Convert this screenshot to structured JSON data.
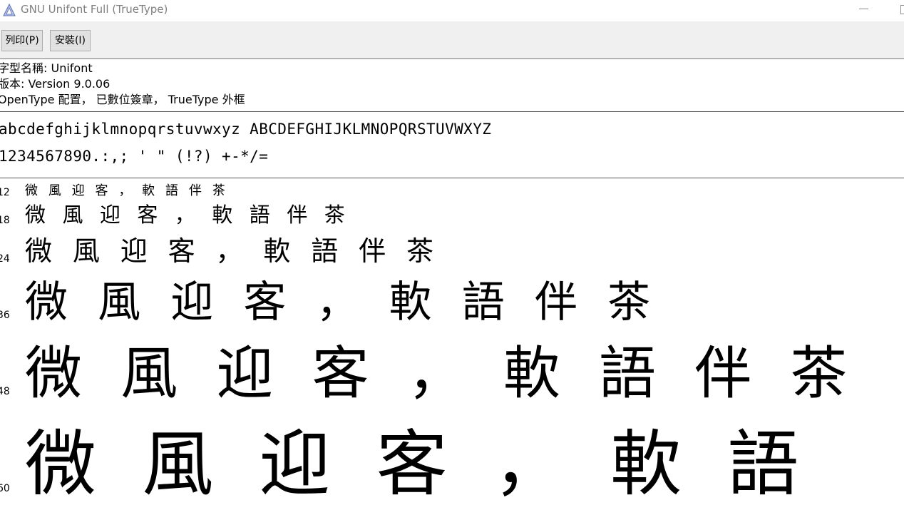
{
  "window": {
    "title": "GNU Unifont Full (TrueType)"
  },
  "toolbar": {
    "print_label": "列印(P)",
    "install_label": "安裝(I)"
  },
  "info": {
    "font_name": "字型名稱: Unifont",
    "version": "版本: Version 9.0.06",
    "features": "OpenType 配置， 已數位簽章， TrueType 外框"
  },
  "samples": {
    "alphabet": "abcdefghijklmnopqrstuvwxyz ABCDEFGHIJKLMNOPQRSTUVWXYZ",
    "digits": "1234567890.:,; ' \" (!?) +-*/="
  },
  "size_samples": [
    {
      "size_label": "12",
      "text": "微 風 迎 客 ， 軟 語 伴 茶"
    },
    {
      "size_label": "18",
      "text": "微 風 迎 客 ， 軟 語 伴 茶"
    },
    {
      "size_label": "24",
      "text": "微 風 迎 客 ， 軟 語 伴 茶"
    },
    {
      "size_label": "36",
      "text": "微 風 迎 客 ， 軟 語 伴 茶"
    },
    {
      "size_label": "48",
      "text": "微 風 迎 客 ， 軟 語 伴 茶"
    },
    {
      "size_label": "60",
      "text": "微 風 迎 客 ， 軟 語"
    }
  ],
  "colors": {
    "toolbar_bg": "#f0f0f0",
    "title_text": "#808080",
    "separator": "#555555"
  },
  "icons": {
    "app": "font-viewer-icon",
    "minimize": "minimize-icon",
    "maximize": "maximize-icon"
  }
}
